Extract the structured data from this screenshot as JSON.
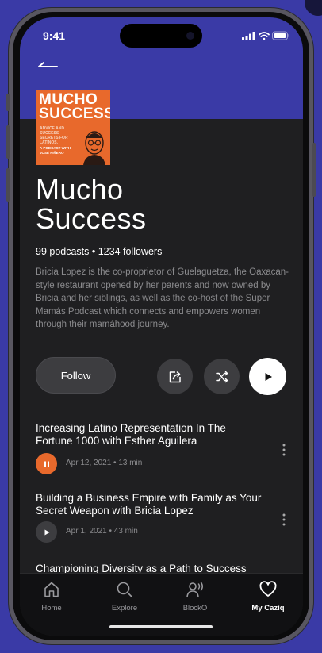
{
  "status_bar": {
    "time": "9:41"
  },
  "podcast": {
    "cover": {
      "title": "MUCHO SUCCESS",
      "subtitle": "ADVICE AND SUCCESS SECRETS FOR LATINOS.",
      "host": "A PODCAST WITH JOSÉ PIÑERO"
    },
    "title_line1": "Mucho",
    "title_line2": "Success",
    "stats": "99 podcasts • 1234 followers",
    "description": "Bricia Lopez is the co-proprietor of Guelaguetza, the Oaxacan-style restaurant opened by her parents and now owned by Bricia and her siblings, as well as the co-host of the Super Mamás Podcast which connects and empowers women through their mamáhood journey."
  },
  "actions": {
    "follow_label": "Follow"
  },
  "episodes": [
    {
      "title": "Increasing Latino Representation In The Fortune 1000 with Esther Aguilera",
      "meta": "Apr 12, 2021 • 13 min",
      "state": "playing"
    },
    {
      "title": "Building a Business Empire with Family as Your Secret Weapon with Bricia Lopez",
      "meta": "Apr 1, 2021 • 43 min",
      "state": "paused"
    },
    {
      "title": "Championing Diversity as a Path to Success",
      "meta": "",
      "state": "paused"
    }
  ],
  "tabs": [
    {
      "label": "Home",
      "icon": "home-icon"
    },
    {
      "label": "Explore",
      "icon": "search-icon"
    },
    {
      "label": "BlockO",
      "icon": "person-speaking-icon"
    },
    {
      "label": "My Caziq",
      "icon": "heart-icon",
      "active": true
    }
  ],
  "colors": {
    "accent": "#3a3aa6",
    "play_active": "#e8692c",
    "cover": "#e8692c",
    "background": "#1f1f21"
  }
}
